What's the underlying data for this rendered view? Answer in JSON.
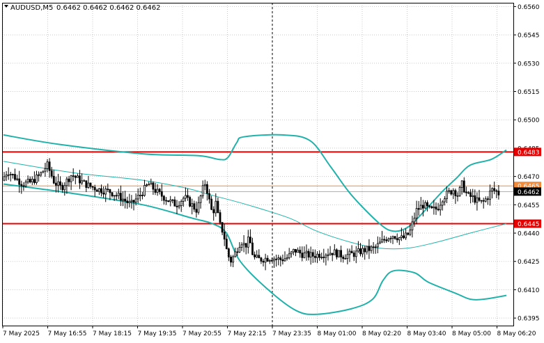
{
  "header": {
    "symbol": "AUDUSD,M5",
    "ohlc": "0.6462 0.6462 0.6462 0.6462"
  },
  "colors": {
    "background": "#ffffff",
    "frame": "#000000",
    "grid": "#c8c8c8",
    "candle": "#000000",
    "bollinger": "#20b2aa",
    "support_resistance": "#e60000",
    "level_orange": "#f08c3c",
    "bid_line": "#808080"
  },
  "chart_data": {
    "type": "candlestick",
    "timeframe": "M5",
    "ylim": [
      0.6391,
      0.6562
    ],
    "y_ticks": [
      "0.6560",
      "0.6545",
      "0.6530",
      "0.6515",
      "0.6500",
      "0.6485",
      "0.6470",
      "0.6455",
      "0.6440",
      "0.6425",
      "0.6410",
      "0.6395"
    ],
    "x_ticks": [
      "7 May 2025",
      "7 May 16:55",
      "7 May 18:15",
      "7 May 19:35",
      "7 May 20:55",
      "7 May 22:15",
      "7 May 23:35",
      "8 May 01:00",
      "8 May 02:20",
      "8 May 03:40",
      "8 May 05:00",
      "8 May 06:20"
    ],
    "period_separator": "7 May 23:35",
    "horizontal_levels": [
      {
        "label": "0.6483",
        "price": 0.6483,
        "color": "#e60000",
        "style": "thick"
      },
      {
        "label": "0.6465",
        "price": 0.6465,
        "color": "#f08c3c",
        "style": "thin"
      },
      {
        "label": "0.6445",
        "price": 0.6445,
        "color": "#e60000",
        "style": "thick"
      }
    ],
    "current_price": {
      "label": "0.6462",
      "price": 0.6462
    },
    "close_path": [
      [
        0,
        0.6468
      ],
      [
        8,
        0.6473
      ],
      [
        20,
        0.6469
      ],
      [
        30,
        0.6466
      ],
      [
        42,
        0.6467
      ],
      [
        55,
        0.6471
      ],
      [
        65,
        0.6476
      ],
      [
        75,
        0.6467
      ],
      [
        85,
        0.6464
      ],
      [
        100,
        0.6471
      ],
      [
        115,
        0.6467
      ],
      [
        125,
        0.6465
      ],
      [
        140,
        0.6463
      ],
      [
        155,
        0.6462
      ],
      [
        170,
        0.6459
      ],
      [
        185,
        0.6455
      ],
      [
        200,
        0.6461
      ],
      [
        210,
        0.6466
      ],
      [
        225,
        0.6461
      ],
      [
        240,
        0.6457
      ],
      [
        250,
        0.6455
      ],
      [
        262,
        0.6459
      ],
      [
        272,
        0.6455
      ],
      [
        280,
        0.6452
      ],
      [
        287,
        0.6462
      ],
      [
        292,
        0.6467
      ],
      [
        297,
        0.6458
      ],
      [
        302,
        0.645
      ],
      [
        307,
        0.6456
      ],
      [
        312,
        0.6445
      ],
      [
        318,
        0.644
      ],
      [
        323,
        0.643
      ],
      [
        328,
        0.6425
      ],
      [
        333,
        0.6428
      ],
      [
        338,
        0.6432
      ],
      [
        343,
        0.6436
      ],
      [
        349,
        0.6433
      ],
      [
        355,
        0.6437
      ],
      [
        361,
        0.6427
      ],
      [
        370,
        0.6426
      ],
      [
        385,
        0.6427
      ],
      [
        400,
        0.6426
      ],
      [
        410,
        0.6427
      ],
      [
        420,
        0.6431
      ],
      [
        430,
        0.6429
      ],
      [
        445,
        0.6428
      ],
      [
        460,
        0.6429
      ],
      [
        475,
        0.643
      ],
      [
        490,
        0.6428
      ],
      [
        505,
        0.6429
      ],
      [
        520,
        0.6431
      ],
      [
        535,
        0.6432
      ],
      [
        550,
        0.6437
      ],
      [
        560,
        0.6439
      ],
      [
        575,
        0.6437
      ],
      [
        585,
        0.644
      ],
      [
        595,
        0.6452
      ],
      [
        605,
        0.6455
      ],
      [
        615,
        0.6452
      ],
      [
        625,
        0.6453
      ],
      [
        633,
        0.6459
      ],
      [
        640,
        0.6461
      ],
      [
        648,
        0.6463
      ],
      [
        655,
        0.646
      ],
      [
        660,
        0.6466
      ],
      [
        668,
        0.646
      ],
      [
        675,
        0.6459
      ],
      [
        682,
        0.6457
      ],
      [
        690,
        0.6456
      ],
      [
        697,
        0.6459
      ],
      [
        703,
        0.6463
      ],
      [
        710,
        0.6462
      ],
      [
        713,
        0.6461
      ]
    ],
    "bollinger_upper": [
      [
        0,
        0.6492
      ],
      [
        80,
        0.6487
      ],
      [
        200,
        0.6482
      ],
      [
        280,
        0.6481
      ],
      [
        310,
        0.6479
      ],
      [
        322,
        0.648
      ],
      [
        335,
        0.6488
      ],
      [
        345,
        0.6491
      ],
      [
        400,
        0.6492
      ],
      [
        440,
        0.6489
      ],
      [
        470,
        0.6475
      ],
      [
        500,
        0.646
      ],
      [
        540,
        0.6445
      ],
      [
        560,
        0.6441
      ],
      [
        580,
        0.6443
      ],
      [
        600,
        0.645
      ],
      [
        630,
        0.6462
      ],
      [
        650,
        0.6469
      ],
      [
        670,
        0.6476
      ],
      [
        700,
        0.6479
      ],
      [
        722,
        0.6484
      ]
    ],
    "bollinger_middle": [
      [
        0,
        0.6478
      ],
      [
        100,
        0.6472
      ],
      [
        200,
        0.6468
      ],
      [
        260,
        0.6464
      ],
      [
        300,
        0.646
      ],
      [
        350,
        0.6455
      ],
      [
        410,
        0.6448
      ],
      [
        450,
        0.6441
      ],
      [
        500,
        0.6435
      ],
      [
        540,
        0.6432
      ],
      [
        580,
        0.6432
      ],
      [
        620,
        0.6435
      ],
      [
        670,
        0.644
      ],
      [
        722,
        0.6445
      ]
    ],
    "bollinger_lower": [
      [
        0,
        0.6466
      ],
      [
        100,
        0.6461
      ],
      [
        200,
        0.6455
      ],
      [
        270,
        0.6448
      ],
      [
        300,
        0.6445
      ],
      [
        320,
        0.644
      ],
      [
        340,
        0.6425
      ],
      [
        380,
        0.641
      ],
      [
        420,
        0.6399
      ],
      [
        450,
        0.6397
      ],
      [
        500,
        0.64
      ],
      [
        530,
        0.6405
      ],
      [
        545,
        0.6415
      ],
      [
        560,
        0.642
      ],
      [
        590,
        0.6419
      ],
      [
        610,
        0.6414
      ],
      [
        650,
        0.6408
      ],
      [
        670,
        0.6405
      ],
      [
        690,
        0.6405
      ],
      [
        722,
        0.6407
      ]
    ]
  }
}
